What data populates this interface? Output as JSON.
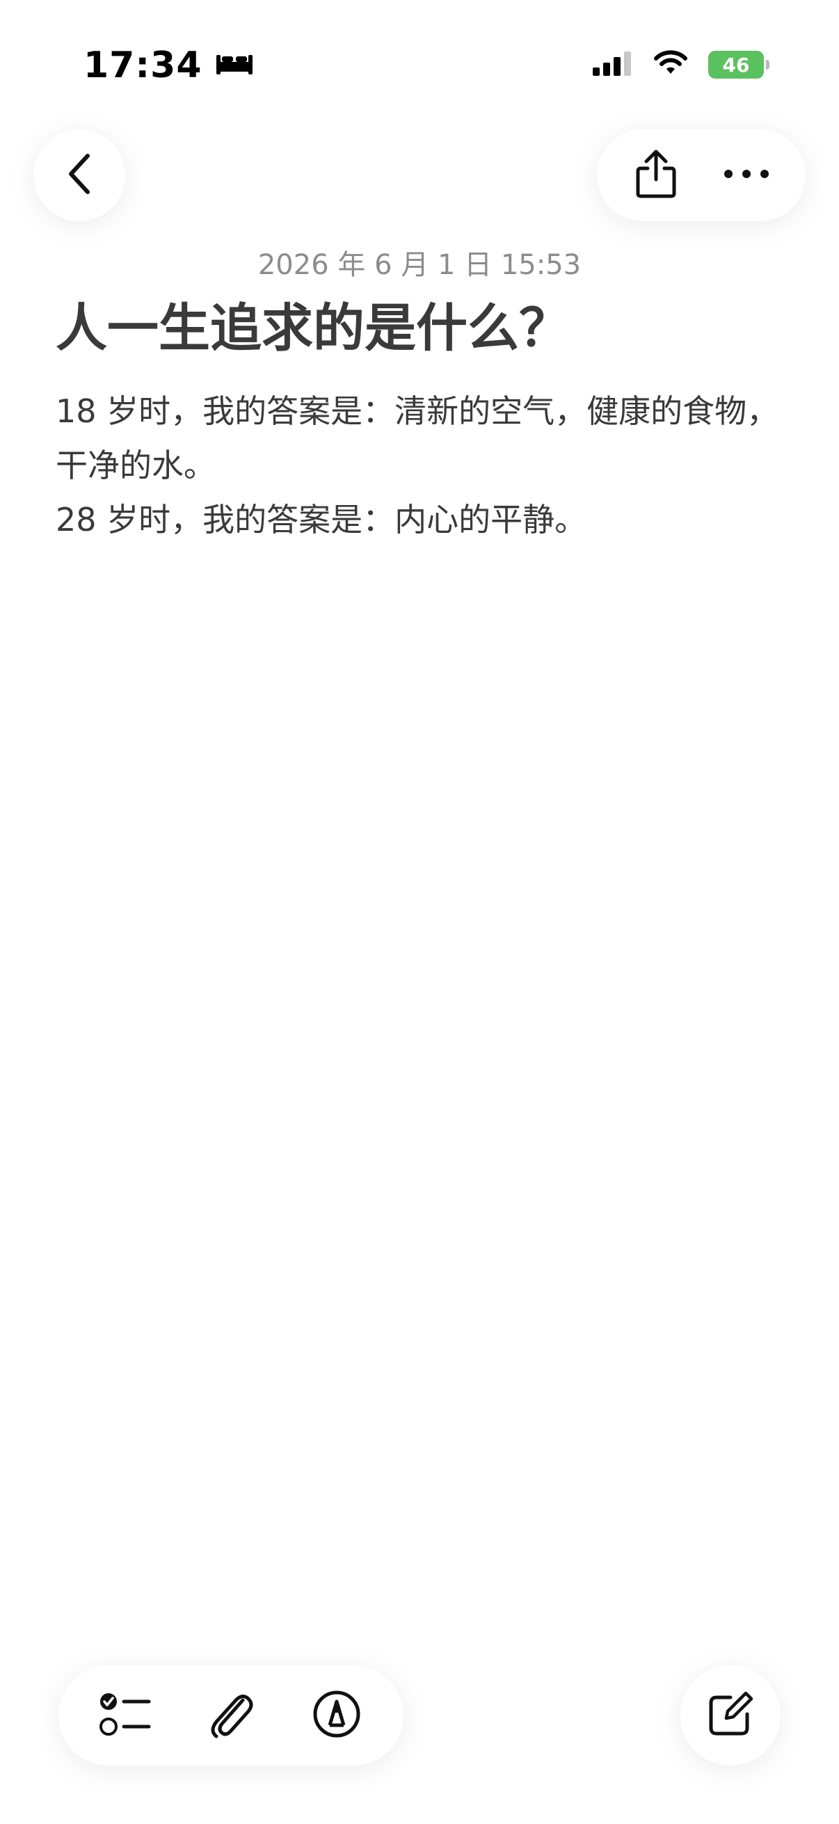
{
  "status_bar": {
    "time": "17:34",
    "battery": "46"
  },
  "note": {
    "date": "2026 年 6 月 1 日 15:53",
    "title": "人一生追求的是什么？",
    "lines": [
      "18 岁时，我的答案是：清新的空气，健康的食物，干净的水。",
      "28 岁时，我的答案是：内心的平静。"
    ]
  },
  "icons": {
    "back": "chevron-left-icon",
    "share": "share-icon",
    "more": "more-icon",
    "checklist": "checklist-icon",
    "attach": "paperclip-icon",
    "markup": "markup-pen-icon",
    "compose": "compose-icon",
    "sleep": "bed-icon",
    "signal": "cellular-signal-icon",
    "wifi": "wifi-icon"
  },
  "colors": {
    "battery": "#5ac15e",
    "text": "#3a3a3a",
    "date": "#8c8c8c"
  }
}
